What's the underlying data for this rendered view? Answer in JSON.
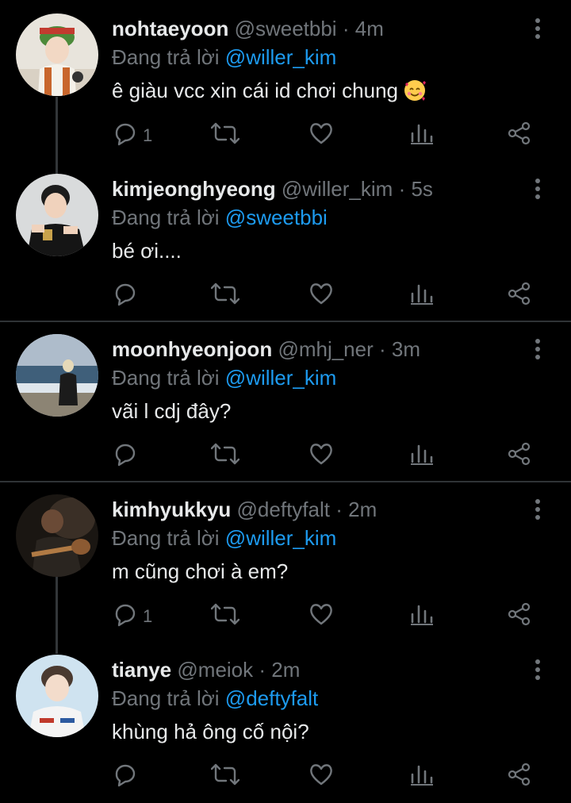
{
  "colors": {
    "background": "#000000",
    "text": "#e7e9ea",
    "secondary": "#71767b",
    "accent": "#1d9bf0",
    "divider": "#2f3336"
  },
  "replying_prefix": "Đang trả lời",
  "tweets": [
    {
      "name": "nohtaeyoon",
      "handle": "@sweetbbi",
      "sep": "·",
      "time": "4m",
      "reply_to": "@willer_kim",
      "text": "ê giàu vcc xin cái id chơi chung",
      "emoji": "smiling-face-with-hearts-icon",
      "reply_count": "1"
    },
    {
      "name": "kimjeonghyeong",
      "handle": "@willer_kim",
      "sep": "·",
      "time": "5s",
      "reply_to": "@sweetbbi",
      "text": "bé ơi....",
      "reply_count": ""
    },
    {
      "name": "moonhyeonjoon",
      "handle": "@mhj_ner",
      "sep": "·",
      "time": "3m",
      "reply_to": "@willer_kim",
      "text": "vãi l cdj đây?",
      "reply_count": ""
    },
    {
      "name": "kimhyukkyu",
      "handle": "@deftyfalt",
      "sep": "·",
      "time": "2m",
      "reply_to": "@willer_kim",
      "text": "m cũng chơi à em?",
      "reply_count": "1"
    },
    {
      "name": "tianye",
      "handle": "@meiok",
      "sep": "·",
      "time": "2m",
      "reply_to": "@deftyfalt",
      "text": "khùng hả ông cố nội?",
      "reply_count": ""
    }
  ],
  "icons": {
    "reply": "reply-icon",
    "retweet": "retweet-icon",
    "like": "heart-icon",
    "views": "views-icon",
    "share": "share-icon",
    "more": "more-vertical-icon"
  }
}
